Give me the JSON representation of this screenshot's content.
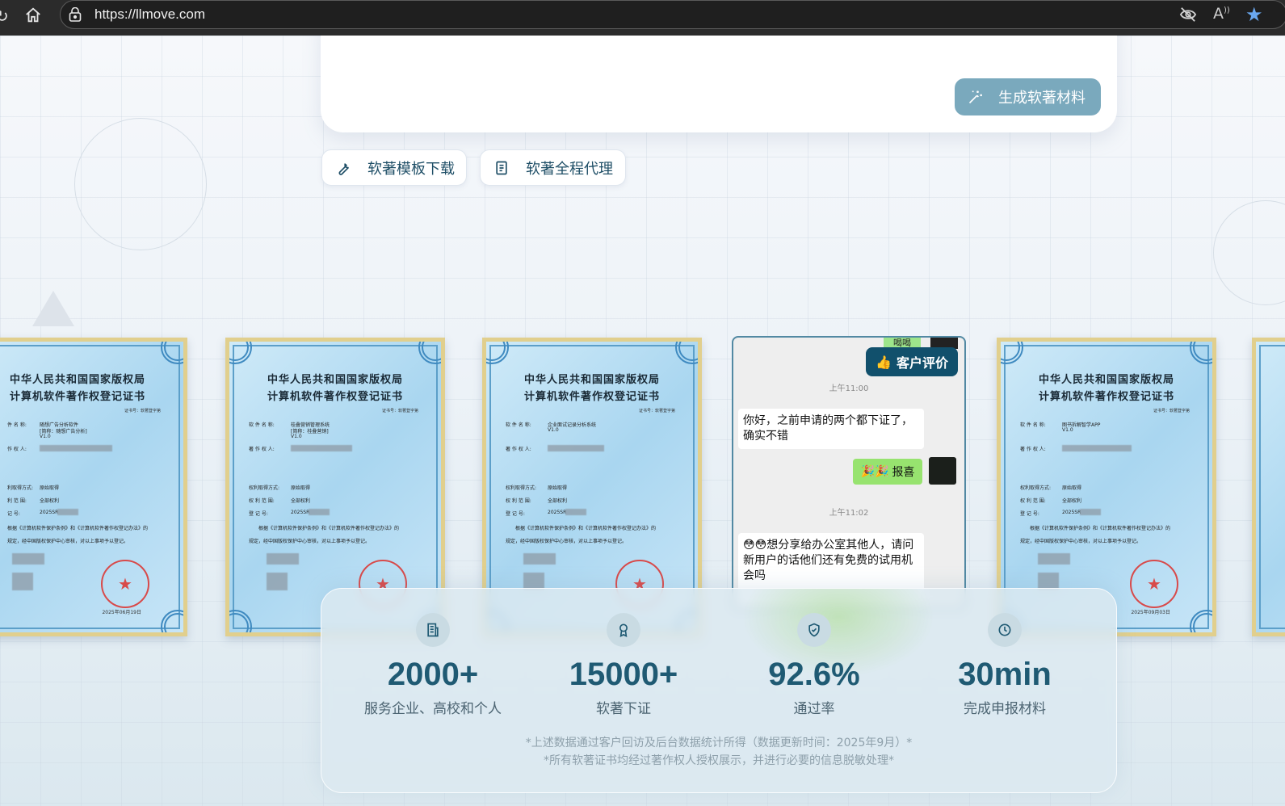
{
  "browser": {
    "url": "https://llmove.com",
    "icons": [
      "refresh-icon",
      "home-icon",
      "lock-icon",
      "eye-off-icon",
      "read-aloud-icon",
      "favorite-star-icon"
    ]
  },
  "panel": {
    "generate_label": "生成软著材料"
  },
  "actions": {
    "template_label": "软著模板下载",
    "agency_label": "软著全程代理"
  },
  "certificates": [
    {
      "title1": "中华人民共和国国家版权局",
      "title2": "计算机软件著作权登记证书",
      "cert_no": "证书号：软著登字第",
      "name_label": "件 名 称:",
      "name": "随想广告分析软件",
      "alias": "[简称：随想广告分析]",
      "version": "V1.0",
      "owner_label": "作 权 人:",
      "method_label": "利取得方式:",
      "method": "原始取得",
      "scope_label": "利 范 围:",
      "scope": "全部权利",
      "reg_label": "记 号:",
      "reg": "2025SR",
      "law": "根据《计算机软件保护条例》和《计算机软件著作权登记办法》的",
      "law2": "规定，经中国版权保护中心审核，对以上事项予以登记。",
      "date": "2025年06月19日"
    },
    {
      "title1": "中华人民共和国国家版权局",
      "title2": "计算机软件著作权登记证书",
      "cert_no": "证书号：软著登字第",
      "name_label": "软 件 名 称:",
      "name": "桂叠营销管理系统",
      "alias": "[简称：桂叠营销]",
      "version": "V1.0",
      "owner_label": "著 作 权 人:",
      "method_label": "权利取得方式:",
      "method": "原始取得",
      "scope_label": "权 利 范 围:",
      "scope": "全部权利",
      "reg_label": "登 记 号:",
      "reg": "2025SR",
      "law": "根据《计算机软件保护条例》和《计算机软件著作权登记办法》的",
      "law2": "规定，经中国版权保护中心审核，对以上事项予以登记。",
      "date": ""
    },
    {
      "title1": "中华人民共和国国家版权局",
      "title2": "计算机软件著作权登记证书",
      "cert_no": "证书号：软著登字第",
      "name_label": "软 件 名 称:",
      "name": "企业面试记录分析系统",
      "alias": "",
      "version": "V1.0",
      "owner_label": "著 作 权 人:",
      "method_label": "权利取得方式:",
      "method": "原始取得",
      "scope_label": "权 利 范 围:",
      "scope": "全部权利",
      "reg_label": "登 记 号:",
      "reg": "2025SR",
      "law": "根据《计算机软件保护条例》和《计算机软件著作权登记办法》的",
      "law2": "规定，经中国版权保护中心审核，对以上事项予以登记。",
      "date": ""
    },
    {
      "title1": "中华人民共和国国家版权局",
      "title2": "计算机软件著作权登记证书",
      "cert_no": "证书号：软著登字第",
      "name_label": "软 件 名 称:",
      "name": "图书拆解智学APP",
      "alias": "",
      "version": "V1.0",
      "owner_label": "著 作 权 人:",
      "method_label": "权利取得方式:",
      "method": "原始取得",
      "scope_label": "权 利 范 围:",
      "scope": "全部权利",
      "reg_label": "登 记 号:",
      "reg": "2025SR",
      "law": "根据《计算机软件保护条例》和《计算机软件著作权登记办法》的",
      "law2": "规定，经中国版权保护中心审核，对以上事项予以登记。",
      "date": "2025年09月03日"
    }
  ],
  "chat": {
    "top_bubble": "喝喝",
    "badge": "客户评价",
    "time1": "上午11:00",
    "msg1": "你好，之前申请的两个都下证了，确实不错",
    "me_msg": "报喜",
    "time2": "上午11:02",
    "msg2": "😳😳想分享给办公室其他人，请问新用户的话他们还有免费的试用机会吗"
  },
  "stats": [
    {
      "icon": "building-icon",
      "value": "2000+",
      "label": "服务企业、高校和个人"
    },
    {
      "icon": "award-icon",
      "value": "15000+",
      "label": "软著下证"
    },
    {
      "icon": "shield-check-icon",
      "value": "92.6%",
      "label": "通过率"
    },
    {
      "icon": "clock-icon",
      "value": "30min",
      "label": "完成申报材料"
    }
  ],
  "notes": {
    "line1": "*上述数据通过客户回访及后台数据统计所得（数据更新时间：2025年9月）*",
    "line2": "*所有软著证书均经过著作权人授权展示，并进行必要的信息脱敏处理*"
  },
  "colors": {
    "accent": "#1f5a73",
    "generate_button": "#7aa9bd",
    "badge": "#11506c"
  }
}
